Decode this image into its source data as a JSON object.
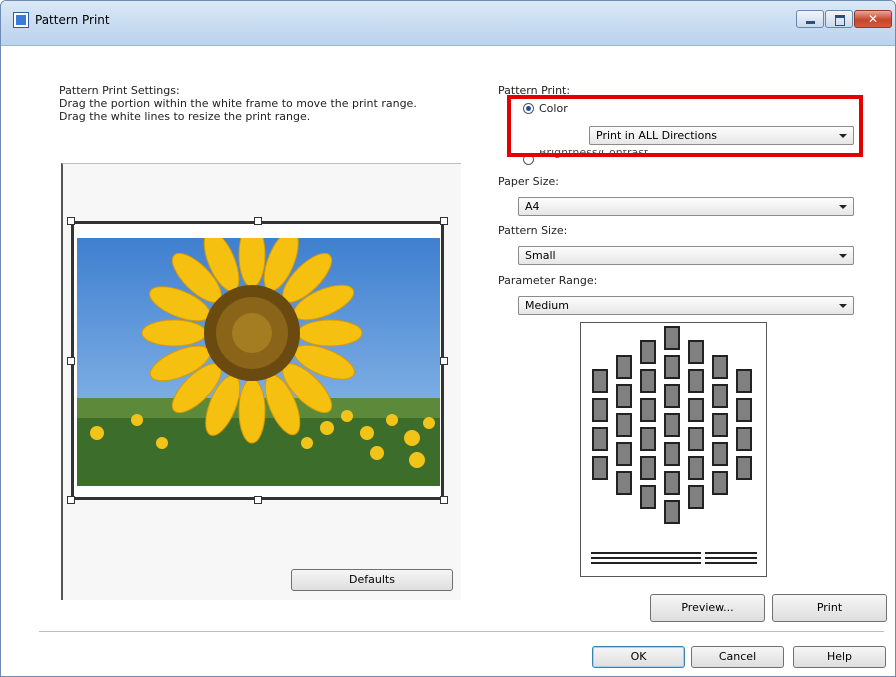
{
  "window": {
    "title": "Pattern Print",
    "controls": {
      "minimize": "minimize",
      "maximize": "maximize",
      "close": "✕"
    }
  },
  "instructions": {
    "line1": "Pattern Print Settings:",
    "line2": "Drag the portion within the white frame to move the print range.",
    "line3": "Drag the white lines to resize the print range."
  },
  "pattern_print": {
    "label": "Pattern Print:",
    "color_option": "Color",
    "color_selected": true,
    "direction_value": "Print in ALL Directions",
    "brightness_option": "Brightness/Contrast",
    "brightness_selected": false
  },
  "paper_size": {
    "label": "Paper Size:",
    "value": "A4"
  },
  "pattern_size": {
    "label": "Pattern Size:",
    "value": "Small"
  },
  "parameter_range": {
    "label": "Parameter Range:",
    "value": "Medium"
  },
  "buttons": {
    "defaults": "Defaults",
    "preview": "Preview...",
    "print": "Print",
    "ok": "OK",
    "cancel": "Cancel",
    "help": "Help"
  },
  "colors": {
    "highlight": "#e20000",
    "sky": "#4a90d9",
    "petal": "#f5c010",
    "pattern_cell": "#808080"
  },
  "icons": [
    "app-icon",
    "minimize-icon",
    "maximize-icon",
    "close-icon",
    "chevron-down-icon",
    "radio-icon",
    "resize-handle-icon"
  ]
}
